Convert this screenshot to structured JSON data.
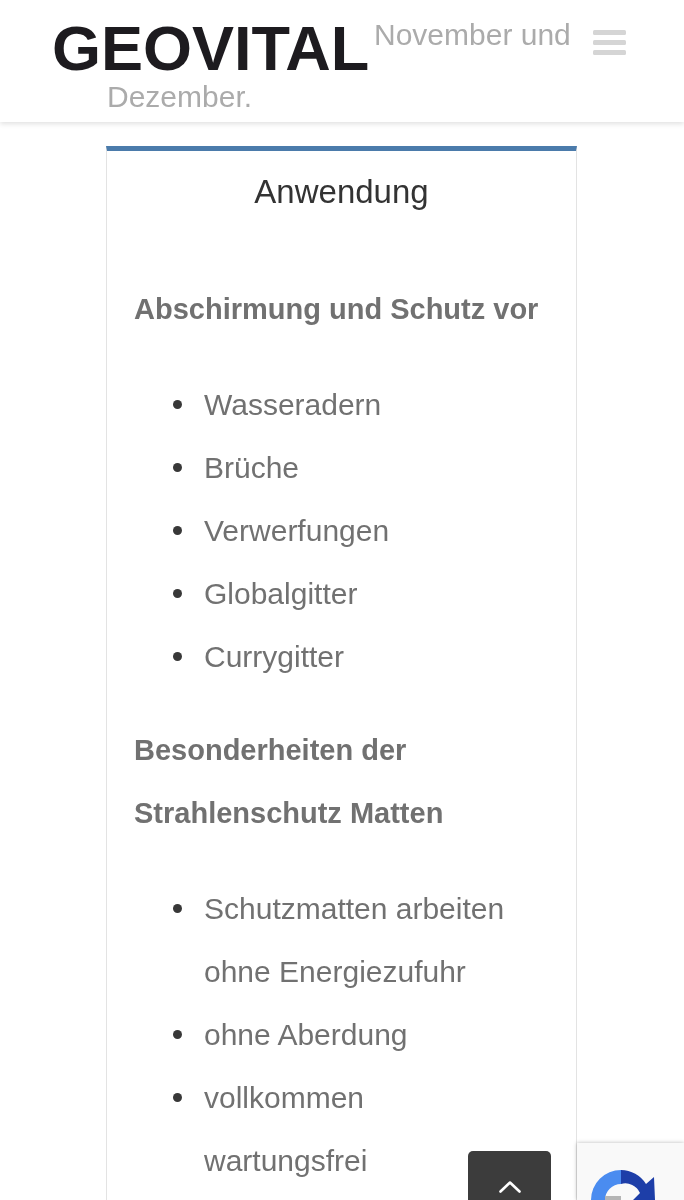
{
  "header": {
    "logo": "GEOVITAL",
    "background_text": [
      "November und",
      "Dezember."
    ]
  },
  "card": {
    "title": "Anwendung",
    "sections": [
      {
        "heading": "Abschirmung und Schutz vor",
        "items": [
          "Wasseradern",
          "Brüche",
          "Verwerfungen",
          "Globalgitter",
          "Currygitter"
        ]
      },
      {
        "heading": "Besonderheiten der Strahlenschutz Matten",
        "items": [
          "Schutzmatten arbeiten ohne Energiezufuhr",
          "ohne Aberdung",
          "vollkommen wartungsfrei"
        ]
      }
    ]
  }
}
